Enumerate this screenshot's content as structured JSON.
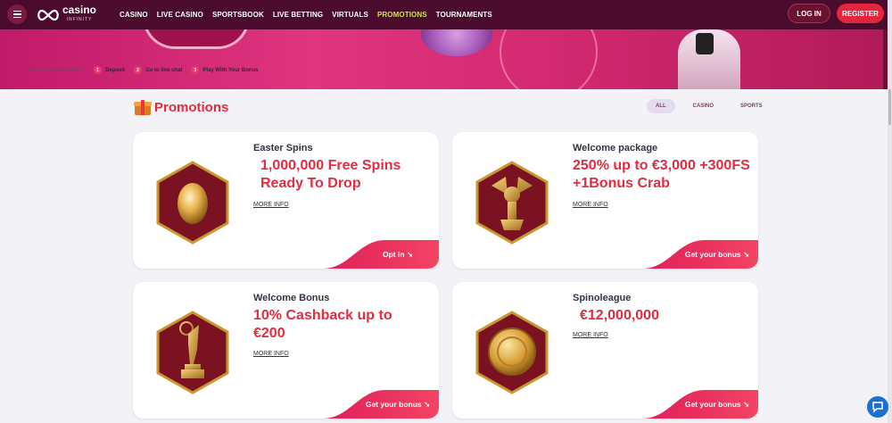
{
  "header": {
    "logo_text": "casino",
    "logo_sub": "INFINITY",
    "nav": [
      {
        "label": "CASINO",
        "active": false
      },
      {
        "label": "LIVE CASINO",
        "active": false
      },
      {
        "label": "SPORTSBOOK",
        "active": false
      },
      {
        "label": "LIVE BETTING",
        "active": false
      },
      {
        "label": "VIRTUALS",
        "active": false
      },
      {
        "label": "PROMOTIONS",
        "active": true
      },
      {
        "label": "TOURNAMENTS",
        "active": false
      }
    ],
    "login_label": "LOG IN",
    "register_label": "REGISTER"
  },
  "steps": {
    "label": "How to receive bonus?",
    "items": [
      {
        "num": "1",
        "text": "Deposit"
      },
      {
        "num": "2",
        "text": "Go to live chat"
      },
      {
        "num": "3",
        "text": "Play With Your Bonus"
      }
    ]
  },
  "promotions": {
    "title": "Promotions",
    "filters": [
      "ALL",
      "CASINO",
      "SPORTS"
    ],
    "active_filter": "ALL",
    "cards": [
      {
        "title": "Easter Spins",
        "amount": "1,000,000 Free Spins Ready To Drop",
        "more": "MORE INFO",
        "cta": "Opt in ↘",
        "icon": "golden-egg-icon"
      },
      {
        "title": "Welcome package",
        "amount": "250% up to €3,000 +300FS +1Bonus Crab",
        "more": "MORE INFO",
        "cta": "Get your bonus ↘",
        "icon": "winged-lion-trophy-icon"
      },
      {
        "title": "Welcome Bonus",
        "amount": "10% Cashback up to €200",
        "more": "MORE INFO",
        "cta": "Get your bonus ↘",
        "icon": "emmy-statue-icon"
      },
      {
        "title": "Spinoleague",
        "amount": "€12,000,000",
        "more": "MORE INFO",
        "cta": "Get your bonus ↘",
        "icon": "gold-coin-icon"
      }
    ]
  },
  "colors": {
    "header_bg": "#4a0b2c",
    "accent_red": "#e12d3f",
    "active_nav": "#c6e64a",
    "cta_gradient_start": "#e01e5a",
    "cta_gradient_end": "#f24463"
  }
}
